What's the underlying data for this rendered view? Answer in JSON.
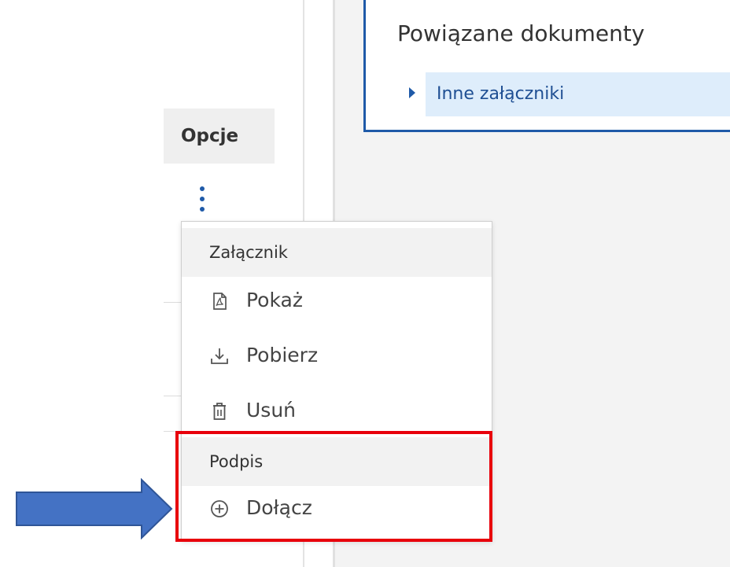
{
  "related": {
    "title": "Powiązane dokumenty",
    "tree_item": "Inne załączniki"
  },
  "options": {
    "header": "Opcje",
    "kebab_icon": "more-vertical-icon"
  },
  "menu": {
    "group_attachment": "Załącznik",
    "show_label": "Pokaż",
    "show_icon": "pdf-file-icon",
    "download_label": "Pobierz",
    "download_icon": "download-icon",
    "delete_label": "Usuń",
    "delete_icon": "trash-icon",
    "group_signature": "Podpis",
    "attach_label": "Dołącz",
    "attach_icon": "plus-circle-icon"
  },
  "annotations": {
    "highlight_color": "#e8000b",
    "arrow_color": "#4472c4"
  },
  "colors": {
    "accent": "#1f5aa8",
    "selected_row": "#deedfb"
  }
}
